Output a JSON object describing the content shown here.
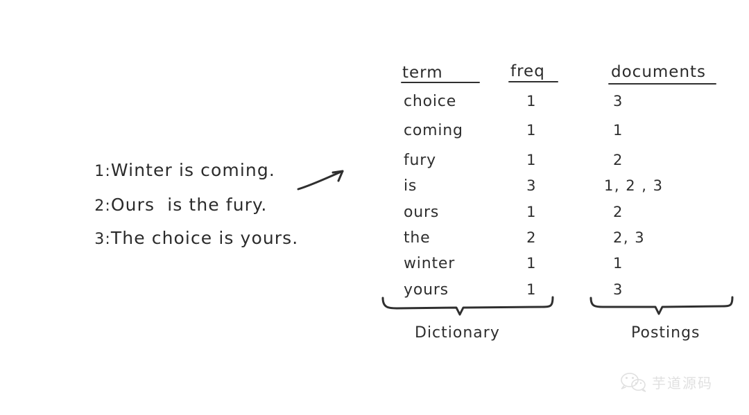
{
  "documents": {
    "lines": [
      {
        "num": "1:",
        "text": "Winter is coming."
      },
      {
        "num": "2:",
        "text": "Ours  is the fury."
      },
      {
        "num": "3:",
        "text": "The choice is yours."
      }
    ]
  },
  "arrow": {
    "icon": "curved-right-arrow"
  },
  "table": {
    "headers": {
      "term": "term",
      "freq": "freq",
      "documents": "documents"
    },
    "rows": [
      {
        "term": "choice",
        "freq": "1",
        "documents": "3"
      },
      {
        "term": "coming",
        "freq": "1",
        "documents": "1"
      },
      {
        "term": "fury",
        "freq": "1",
        "documents": "2"
      },
      {
        "term": "is",
        "freq": "3",
        "documents": "1, 2 , 3"
      },
      {
        "term": "ours",
        "freq": "1",
        "documents": "2"
      },
      {
        "term": "the",
        "freq": "2",
        "documents": "2, 3"
      },
      {
        "term": "winter",
        "freq": "1",
        "documents": "1"
      },
      {
        "term": "yours",
        "freq": "1",
        "documents": "3"
      }
    ]
  },
  "braces": {
    "dictionary_label": "Dictionary",
    "postings_label": "Postings"
  },
  "watermark": {
    "icon": "wechat-logo",
    "text": "芋道源码"
  },
  "colors": {
    "background": "#ffffff",
    "ink": "#2f2f2f",
    "watermark": "#9a9a9a"
  }
}
